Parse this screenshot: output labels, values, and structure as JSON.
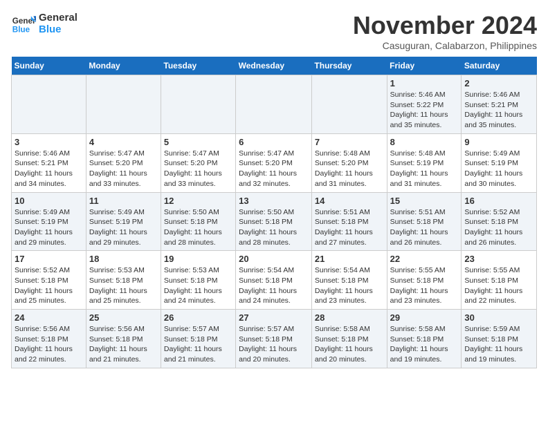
{
  "header": {
    "logo_line1": "General",
    "logo_line2": "Blue",
    "month": "November 2024",
    "location": "Casuguran, Calabarzon, Philippines"
  },
  "weekdays": [
    "Sunday",
    "Monday",
    "Tuesday",
    "Wednesday",
    "Thursday",
    "Friday",
    "Saturday"
  ],
  "weeks": [
    [
      {
        "day": "",
        "info": ""
      },
      {
        "day": "",
        "info": ""
      },
      {
        "day": "",
        "info": ""
      },
      {
        "day": "",
        "info": ""
      },
      {
        "day": "",
        "info": ""
      },
      {
        "day": "1",
        "info": "Sunrise: 5:46 AM\nSunset: 5:22 PM\nDaylight: 11 hours and 35 minutes."
      },
      {
        "day": "2",
        "info": "Sunrise: 5:46 AM\nSunset: 5:21 PM\nDaylight: 11 hours and 35 minutes."
      }
    ],
    [
      {
        "day": "3",
        "info": "Sunrise: 5:46 AM\nSunset: 5:21 PM\nDaylight: 11 hours and 34 minutes."
      },
      {
        "day": "4",
        "info": "Sunrise: 5:47 AM\nSunset: 5:20 PM\nDaylight: 11 hours and 33 minutes."
      },
      {
        "day": "5",
        "info": "Sunrise: 5:47 AM\nSunset: 5:20 PM\nDaylight: 11 hours and 33 minutes."
      },
      {
        "day": "6",
        "info": "Sunrise: 5:47 AM\nSunset: 5:20 PM\nDaylight: 11 hours and 32 minutes."
      },
      {
        "day": "7",
        "info": "Sunrise: 5:48 AM\nSunset: 5:20 PM\nDaylight: 11 hours and 31 minutes."
      },
      {
        "day": "8",
        "info": "Sunrise: 5:48 AM\nSunset: 5:19 PM\nDaylight: 11 hours and 31 minutes."
      },
      {
        "day": "9",
        "info": "Sunrise: 5:49 AM\nSunset: 5:19 PM\nDaylight: 11 hours and 30 minutes."
      }
    ],
    [
      {
        "day": "10",
        "info": "Sunrise: 5:49 AM\nSunset: 5:19 PM\nDaylight: 11 hours and 29 minutes."
      },
      {
        "day": "11",
        "info": "Sunrise: 5:49 AM\nSunset: 5:19 PM\nDaylight: 11 hours and 29 minutes."
      },
      {
        "day": "12",
        "info": "Sunrise: 5:50 AM\nSunset: 5:18 PM\nDaylight: 11 hours and 28 minutes."
      },
      {
        "day": "13",
        "info": "Sunrise: 5:50 AM\nSunset: 5:18 PM\nDaylight: 11 hours and 28 minutes."
      },
      {
        "day": "14",
        "info": "Sunrise: 5:51 AM\nSunset: 5:18 PM\nDaylight: 11 hours and 27 minutes."
      },
      {
        "day": "15",
        "info": "Sunrise: 5:51 AM\nSunset: 5:18 PM\nDaylight: 11 hours and 26 minutes."
      },
      {
        "day": "16",
        "info": "Sunrise: 5:52 AM\nSunset: 5:18 PM\nDaylight: 11 hours and 26 minutes."
      }
    ],
    [
      {
        "day": "17",
        "info": "Sunrise: 5:52 AM\nSunset: 5:18 PM\nDaylight: 11 hours and 25 minutes."
      },
      {
        "day": "18",
        "info": "Sunrise: 5:53 AM\nSunset: 5:18 PM\nDaylight: 11 hours and 25 minutes."
      },
      {
        "day": "19",
        "info": "Sunrise: 5:53 AM\nSunset: 5:18 PM\nDaylight: 11 hours and 24 minutes."
      },
      {
        "day": "20",
        "info": "Sunrise: 5:54 AM\nSunset: 5:18 PM\nDaylight: 11 hours and 24 minutes."
      },
      {
        "day": "21",
        "info": "Sunrise: 5:54 AM\nSunset: 5:18 PM\nDaylight: 11 hours and 23 minutes."
      },
      {
        "day": "22",
        "info": "Sunrise: 5:55 AM\nSunset: 5:18 PM\nDaylight: 11 hours and 23 minutes."
      },
      {
        "day": "23",
        "info": "Sunrise: 5:55 AM\nSunset: 5:18 PM\nDaylight: 11 hours and 22 minutes."
      }
    ],
    [
      {
        "day": "24",
        "info": "Sunrise: 5:56 AM\nSunset: 5:18 PM\nDaylight: 11 hours and 22 minutes."
      },
      {
        "day": "25",
        "info": "Sunrise: 5:56 AM\nSunset: 5:18 PM\nDaylight: 11 hours and 21 minutes."
      },
      {
        "day": "26",
        "info": "Sunrise: 5:57 AM\nSunset: 5:18 PM\nDaylight: 11 hours and 21 minutes."
      },
      {
        "day": "27",
        "info": "Sunrise: 5:57 AM\nSunset: 5:18 PM\nDaylight: 11 hours and 20 minutes."
      },
      {
        "day": "28",
        "info": "Sunrise: 5:58 AM\nSunset: 5:18 PM\nDaylight: 11 hours and 20 minutes."
      },
      {
        "day": "29",
        "info": "Sunrise: 5:58 AM\nSunset: 5:18 PM\nDaylight: 11 hours and 19 minutes."
      },
      {
        "day": "30",
        "info": "Sunrise: 5:59 AM\nSunset: 5:18 PM\nDaylight: 11 hours and 19 minutes."
      }
    ]
  ]
}
